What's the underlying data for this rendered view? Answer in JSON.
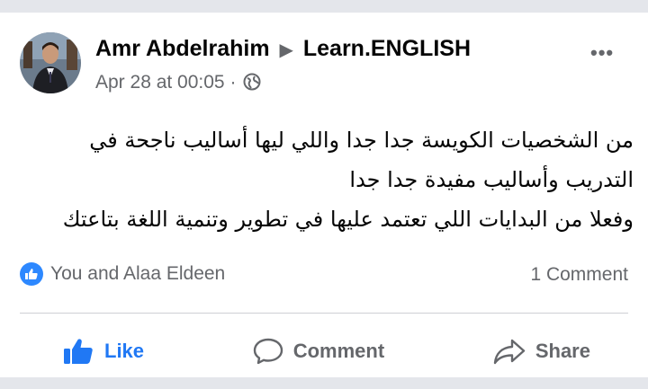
{
  "post": {
    "author": "Amr Abdelrahim",
    "group": "Learn.ENGLISH",
    "timestamp": "Apr 28 at 00:05",
    "separator": "·",
    "text_lines": [
      "من الشخصيات الكويسة جدا جدا واللي ليها أساليب ناجحة في",
      "التدريب وأساليب مفيدة جدا جدا",
      "وفعلا من البدايات اللي تعتمد عليها في تطوير وتنمية اللغة بتاعتك"
    ]
  },
  "reactions": {
    "text": "You and Alaa Eldeen",
    "comments": "1 Comment"
  },
  "actions": {
    "like": "Like",
    "comment": "Comment",
    "share": "Share"
  },
  "colors": {
    "like_blue": "#2078f4",
    "badge_blue": "#2d88ff",
    "secondary_text": "#65676b"
  },
  "icons": {
    "more": "more-options-icon",
    "globe": "globe-icon",
    "like": "thumbs-up-icon",
    "comment": "comment-bubble-icon",
    "share": "share-arrow-icon"
  }
}
